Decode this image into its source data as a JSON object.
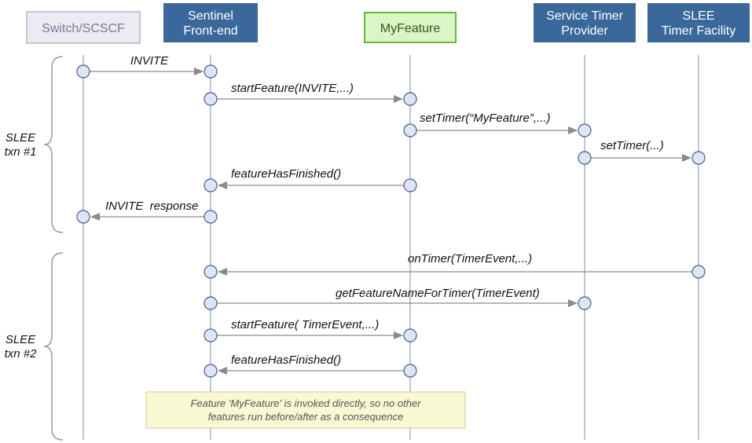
{
  "diagram": {
    "type": "sequence",
    "actors": [
      {
        "id": "switch",
        "label_lines": [
          "Switch/SCSCF"
        ],
        "style": "light"
      },
      {
        "id": "sentinel",
        "label_lines": [
          "Sentinel",
          "Front-end"
        ],
        "style": "blue"
      },
      {
        "id": "myfeature",
        "label_lines": [
          "MyFeature"
        ],
        "style": "green"
      },
      {
        "id": "timerprov",
        "label_lines": [
          "Service Timer",
          "Provider"
        ],
        "style": "blue"
      },
      {
        "id": "slee",
        "label_lines": [
          "SLEE",
          "Timer Facility"
        ],
        "style": "blue"
      }
    ],
    "transactions": [
      {
        "label_lines": [
          "SLEE",
          "txn #1"
        ]
      },
      {
        "label_lines": [
          "SLEE",
          "txn #2"
        ]
      }
    ],
    "messages": [
      {
        "from": "switch",
        "to": "sentinel",
        "label": "INVITE",
        "txn": 1
      },
      {
        "from": "sentinel",
        "to": "myfeature",
        "label": "startFeature(INVITE,...)",
        "txn": 1
      },
      {
        "from": "myfeature",
        "to": "timerprov",
        "label": "setTimer(“MyFeature”,...)",
        "txn": 1
      },
      {
        "from": "timerprov",
        "to": "slee",
        "label": "setTimer(...)",
        "txn": 1
      },
      {
        "from": "myfeature",
        "to": "sentinel",
        "label": "featureHasFinished()",
        "txn": 1
      },
      {
        "from": "sentinel",
        "to": "switch",
        "label": "INVITE  response",
        "txn": 1
      },
      {
        "from": "slee",
        "to": "sentinel",
        "label": "onTimer(TimerEvent,...)",
        "txn": 2
      },
      {
        "from": "sentinel",
        "to": "timerprov",
        "label": "getFeatureNameForTimer(TimerEvent)",
        "txn": 2
      },
      {
        "from": "sentinel",
        "to": "myfeature",
        "label": "startFeature( TimerEvent,...)",
        "txn": 2
      },
      {
        "from": "myfeature",
        "to": "sentinel",
        "label": "featureHasFinished()",
        "txn": 2
      }
    ],
    "note": {
      "lines": [
        "Feature 'MyFeature' is invoked directly, so no other",
        "features run before/after as a consequence"
      ]
    },
    "colors": {
      "blue_box": "#3a689b",
      "blue_box_text": "#ffffff",
      "light_box": "#eeeaf4",
      "light_box_border": "#b8b4c4",
      "light_box_text": "#7c7890",
      "green_box": "#dcf5c6",
      "green_box_border": "#66b83a",
      "green_box_text": "#2e5a16",
      "lifeline": "#aab4c0",
      "arrow": "#8a8a8a",
      "circle_fill": "#dde6f7",
      "circle_stroke": "#4a5a86",
      "note_fill": "#f8f8d2",
      "note_border": "#cccc88",
      "brace": "#9a9a9a"
    }
  }
}
